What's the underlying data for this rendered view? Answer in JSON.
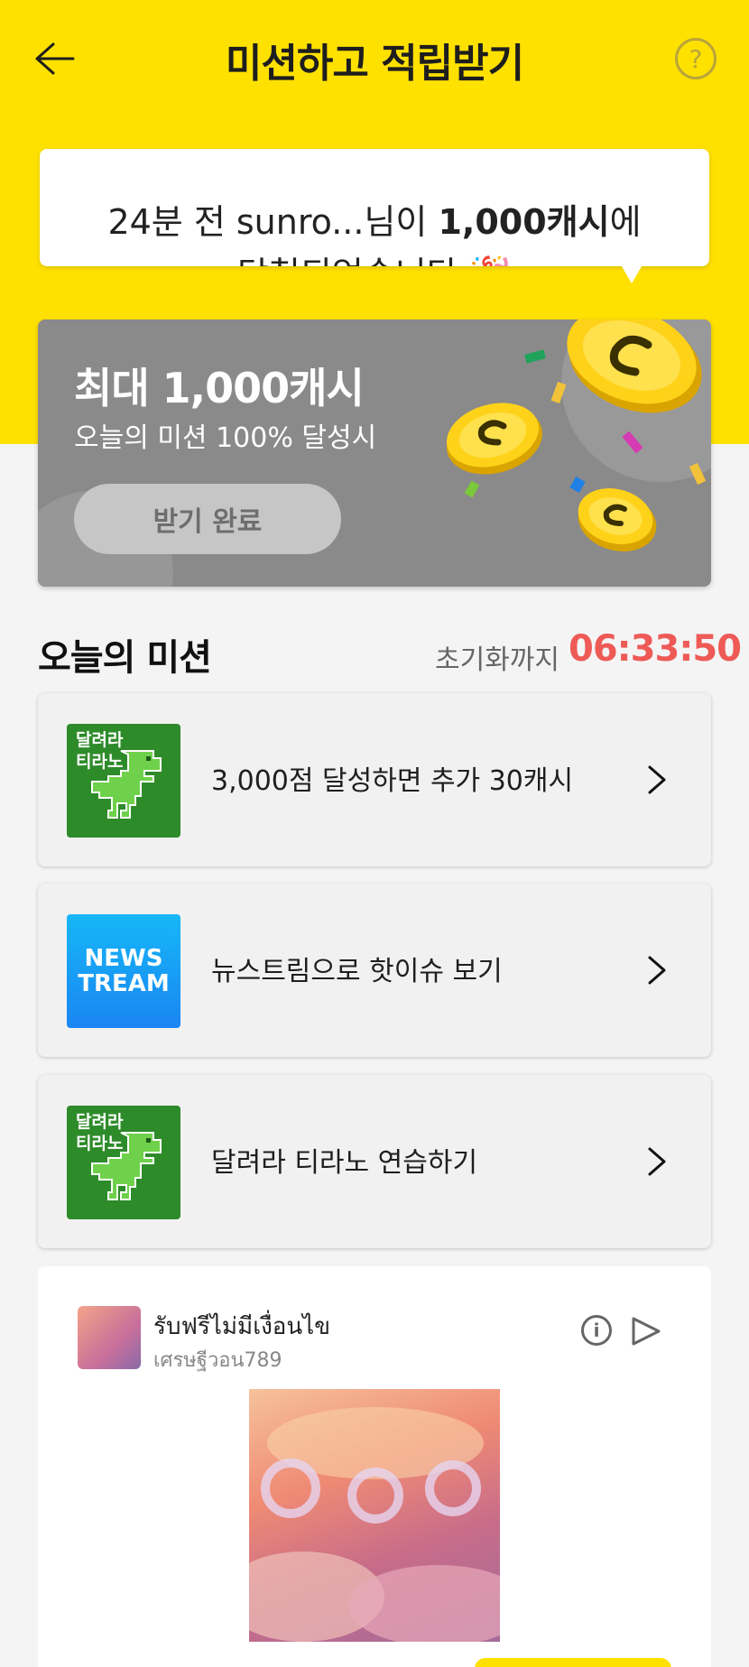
{
  "header": {
    "title": "미션하고 적립받기",
    "help_label": "?"
  },
  "ticker": {
    "prefix": "24분 전 sunro...님이 ",
    "amount": "1,000캐시",
    "suffix": "에",
    "second_line": "당첨되었습니다 🎉"
  },
  "reward": {
    "title": "최대 1,000캐시",
    "subtitle": "오늘의 미션 100% 달성시",
    "button_label": "받기 완료"
  },
  "missions_section": {
    "title": "오늘의 미션",
    "timer_label": "초기화까지",
    "timer_value": "06:33:50"
  },
  "missions": [
    {
      "thumb_text": "달려라\n티라노",
      "label": "3,000점 달성하면 추가 30캐시",
      "icon": "dino-game-icon"
    },
    {
      "thumb_text": "NEWS\nTREAM",
      "label": "뉴스트림으로 핫이슈 보기",
      "icon": "newstream-icon"
    },
    {
      "thumb_text": "달려라\n티라노",
      "label": "달려라 티라노 연습하기",
      "icon": "dino-game-icon"
    }
  ],
  "ad": {
    "title": "รับฟรีไม่มีเงื่อนไข",
    "subtitle": "เศรษฐีวอน789",
    "info_label": "i"
  },
  "colors": {
    "brand_yellow": "#ffe100",
    "timer_red": "#ee5a56",
    "card_gray": "#8a8a8a",
    "dino_green": "#2e8b2a",
    "news_blue": "#1a9af4"
  }
}
